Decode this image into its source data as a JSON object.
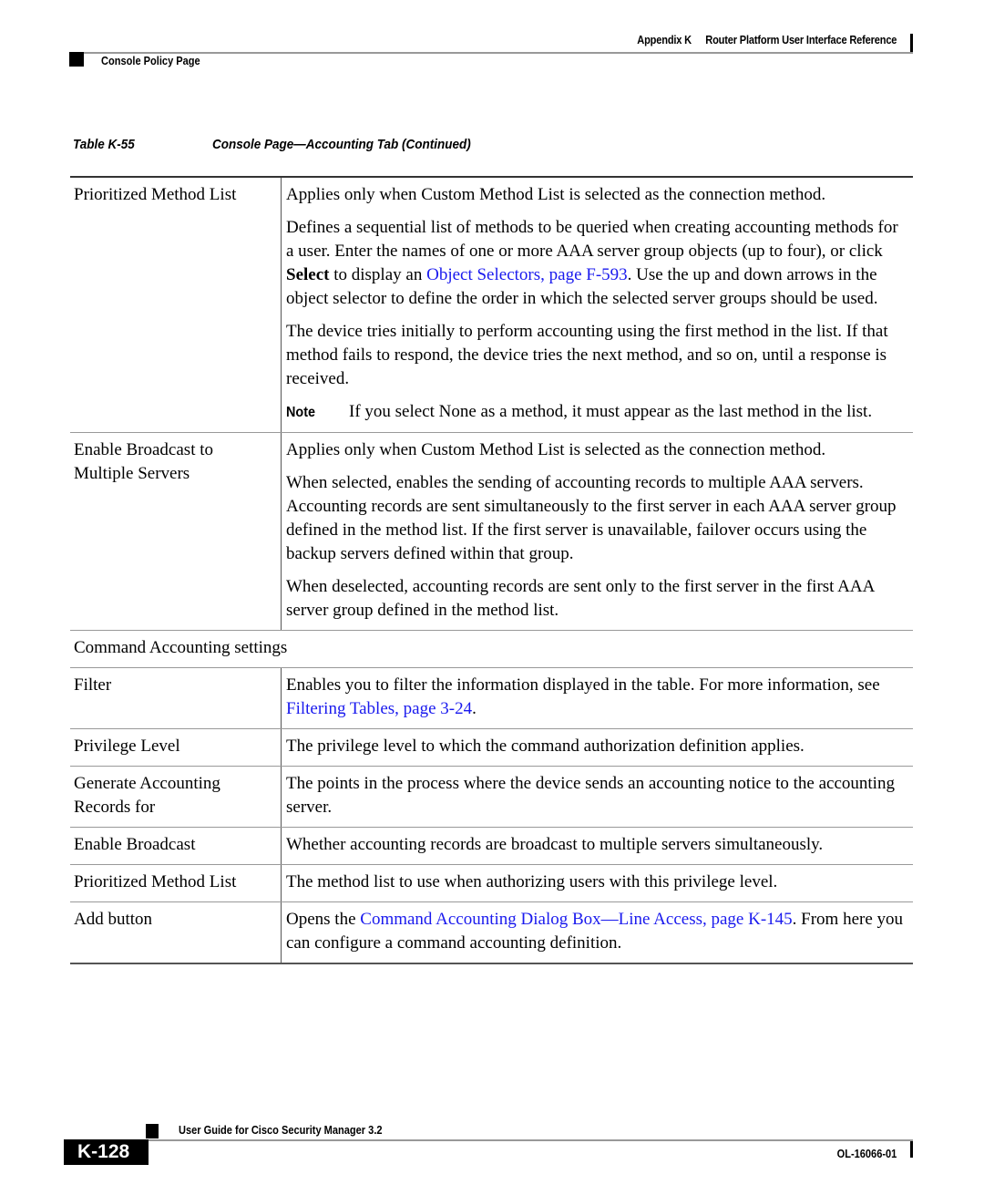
{
  "header": {
    "appendix": "Appendix K",
    "chapter_title": "Router Platform User Interface Reference",
    "section": "Console Policy Page"
  },
  "table": {
    "number": "Table K-55",
    "title": "Console Page—Accounting Tab (Continued)",
    "rows": [
      {
        "term": "Prioritized Method List",
        "p1": "Applies only when Custom Method List is selected as the connection method.",
        "p2_a": "Defines a sequential list of methods to be queried when creating accounting methods for a user. Enter the names of one or more AAA server group objects (up to four), or click ",
        "p2_bold": "Select",
        "p2_b": " to display an ",
        "p2_link": "Object Selectors, page F-593",
        "p2_c": ". Use the up and down arrows in the object selector to define the order in which the selected server groups should be used.",
        "p3": "The device tries initially to perform accounting using the first method in the list. If that method fails to respond, the device tries the next method, and so on, until a response is received.",
        "note_label": "Note",
        "note_text": "If you select None as a method, it must appear as the last method in the list."
      },
      {
        "term": "Enable Broadcast to Multiple Servers",
        "p1": "Applies only when Custom Method List is selected as the connection method.",
        "p2": "When selected, enables the sending of accounting records to multiple AAA servers. Accounting records are sent simultaneously to the first server in each AAA server group defined in the method list. If the first server is unavailable, failover occurs using the backup servers defined within that group.",
        "p3": "When deselected, accounting records are sent only to the first server in the first AAA server group defined in the method list."
      },
      {
        "section_heading": "Command Accounting settings"
      },
      {
        "term": "Filter",
        "text_a": "Enables you to filter the information displayed in the table. For more information, see ",
        "link": "Filtering Tables, page 3-24",
        "text_b": "."
      },
      {
        "term": "Privilege Level",
        "text": "The privilege level to which the command authorization definition applies."
      },
      {
        "term": "Generate Accounting Records for",
        "text": "The points in the process where the device sends an accounting notice to the accounting server."
      },
      {
        "term": "Enable Broadcast",
        "text": "Whether accounting records are broadcast to multiple servers simultaneously."
      },
      {
        "term": "Prioritized Method List",
        "text": "The method list to use when authorizing users with this privilege level."
      },
      {
        "term": "Add button",
        "text_a": "Opens the ",
        "link": "Command Accounting Dialog Box—Line Access, page K-145",
        "text_b": ". From here you can configure a command accounting definition."
      }
    ]
  },
  "footer": {
    "guide_title": "User Guide for Cisco Security Manager 3.2",
    "page_number": "K-128",
    "doc_id": "OL-16066-01"
  },
  "colors": {
    "link": "#1a1aee"
  }
}
